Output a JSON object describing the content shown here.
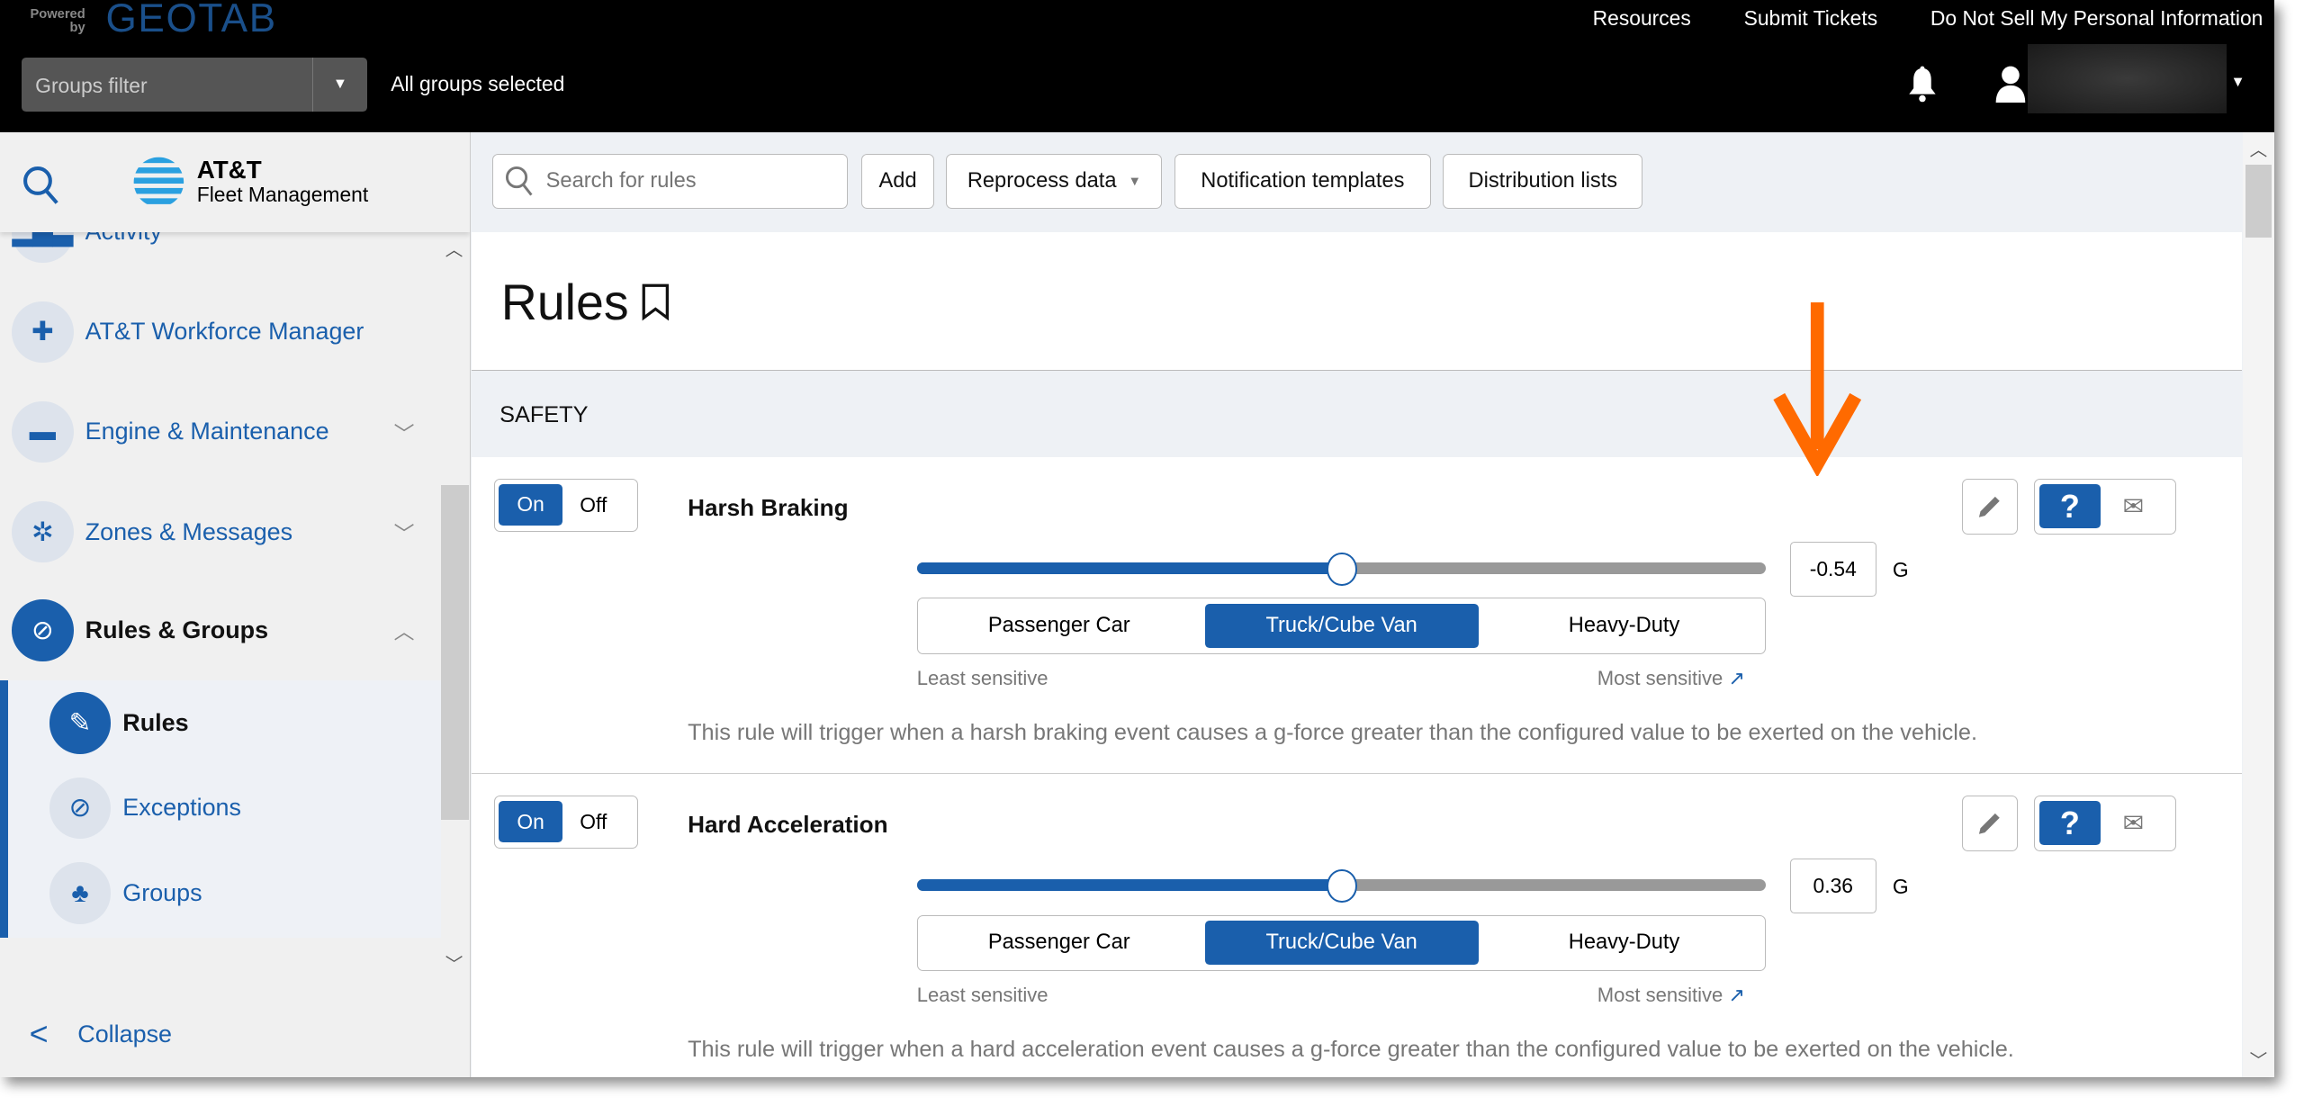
{
  "header": {
    "powered_by": "Powered by",
    "brand": "GEOTAB",
    "links": [
      "Resources",
      "Submit Tickets",
      "Do Not Sell My Personal Information"
    ],
    "groups_filter_placeholder": "Groups filter",
    "groups_status": "All groups selected"
  },
  "sidebar": {
    "logo_line1": "AT&T",
    "logo_line2": "Fleet Management",
    "items": [
      {
        "label": "Activity",
        "icon": "bar-chart-icon"
      },
      {
        "label": "AT&T Workforce Manager",
        "icon": "puzzle-icon"
      },
      {
        "label": "Engine & Maintenance",
        "icon": "engine-icon"
      },
      {
        "label": "Zones & Messages",
        "icon": "zones-icon"
      },
      {
        "label": "Rules & Groups",
        "icon": "prohibited-icon"
      }
    ],
    "subitems": [
      {
        "label": "Rules",
        "icon": "rules-edit-icon"
      },
      {
        "label": "Exceptions",
        "icon": "prohibited-icon"
      },
      {
        "label": "Groups",
        "icon": "hierarchy-icon"
      }
    ],
    "collapse": "Collapse"
  },
  "toolbar": {
    "search_placeholder": "Search for rules",
    "add": "Add",
    "reprocess": "Reprocess data",
    "notification_templates": "Notification templates",
    "distribution_lists": "Distribution lists"
  },
  "page": {
    "title": "Rules",
    "section": "SAFETY"
  },
  "accent": "#1a5fac",
  "annotation_color": "#ff6a00",
  "rules": [
    {
      "on": "On",
      "off": "Off",
      "name": "Harsh Braking",
      "value": "-0.54",
      "unit": "G",
      "slider_percent": 50,
      "vehicle_types": [
        "Passenger Car",
        "Truck/Cube Van",
        "Heavy-Duty"
      ],
      "selected": "Truck/Cube Van",
      "least": "Least sensitive",
      "most": "Most sensitive",
      "description": "This rule will trigger when a harsh braking event causes a g-force greater than the configured value to be exerted on the vehicle."
    },
    {
      "on": "On",
      "off": "Off",
      "name": "Hard Acceleration",
      "value": "0.36",
      "unit": "G",
      "slider_percent": 50,
      "vehicle_types": [
        "Passenger Car",
        "Truck/Cube Van",
        "Heavy-Duty"
      ],
      "selected": "Truck/Cube Van",
      "least": "Least sensitive",
      "most": "Most sensitive",
      "description": "This rule will trigger when a hard acceleration event causes a g-force greater than the configured value to be exerted on the vehicle."
    }
  ]
}
